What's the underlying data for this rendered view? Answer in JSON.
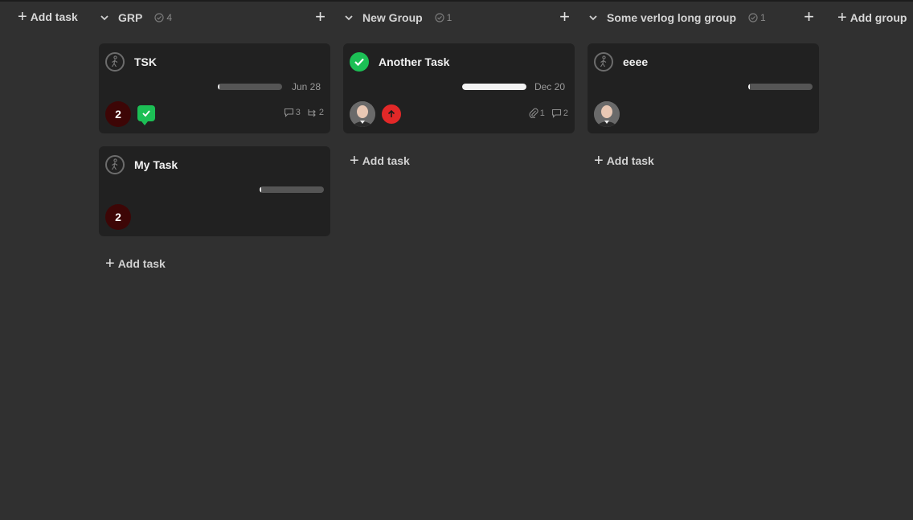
{
  "toolbar": {
    "add_task": "Add task",
    "add_group": "Add group"
  },
  "columns": [
    {
      "title": "GRP",
      "count": "4",
      "add_task": "Add task",
      "cards": [
        {
          "title": "TSK",
          "date": "Jun 28",
          "progress": 0,
          "badge": "2",
          "comments": "3",
          "subtasks": "2"
        },
        {
          "title": "My Task",
          "progress": 0,
          "badge": "2"
        }
      ]
    },
    {
      "title": "New Group",
      "count": "1",
      "add_task": "Add task",
      "cards": [
        {
          "title": "Another Task",
          "date": "Dec 20",
          "progress": 1.0,
          "attachments": "1",
          "comments": "2"
        }
      ]
    },
    {
      "title": "Some verlog long group",
      "count": "1",
      "add_task": "Add task",
      "cards": [
        {
          "title": "eeee",
          "progress": 0
        }
      ]
    }
  ],
  "icons": {
    "status_todo": "person-walking-icon",
    "status_done": "check-circle-icon",
    "comment": "comment-icon",
    "subtask": "subtask-icon",
    "attachment": "paperclip-icon",
    "priority": "arrow-up-icon"
  },
  "colors": {
    "done": "#1cbf55",
    "priority_high": "#e22828",
    "badge_bg": "#3d0606"
  }
}
